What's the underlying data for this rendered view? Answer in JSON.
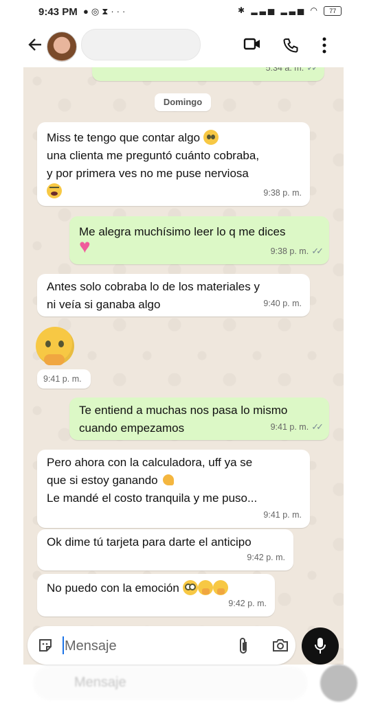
{
  "status_bar": {
    "time": "9:43 PM",
    "battery": "77"
  },
  "header": {
    "back_icon": "arrow-left-icon",
    "video_icon": "video-call-icon",
    "call_icon": "phone-icon",
    "menu_icon": "more-vert-icon"
  },
  "chat": {
    "prev_time": "5:34 a. m.",
    "day_label": "Domingo",
    "messages": [
      {
        "dir": "in",
        "lines": [
          "Miss te tengo que contar algo",
          "una clienta me preguntó cuánto cobraba,",
          "y por primera ves no me puse nerviosa"
        ],
        "time": "9:38 p. m."
      },
      {
        "dir": "out",
        "lines": [
          "Me alegra muchísimo leer lo q me dices"
        ],
        "time": "9:38 p. m."
      },
      {
        "dir": "in",
        "lines": [
          "Antes solo cobraba lo de los materiales y",
          "ni veía si ganaba algo"
        ],
        "time": "9:40 p. m."
      },
      {
        "dir": "in",
        "lines": [],
        "time": "9:41 p. m."
      },
      {
        "dir": "out",
        "lines": [
          "Te entiend a muchas nos pasa lo mismo",
          "cuando empezamos"
        ],
        "time": "9:41 p. m."
      },
      {
        "dir": "in",
        "lines": [
          "Pero ahora con la calculadora, uff ya se",
          "que si estoy ganando",
          "Le mandé el costo tranquila y me puso..."
        ],
        "time": "9:41 p. m."
      },
      {
        "dir": "in",
        "lines": [
          "Ok dime tú tarjeta para darte el anticipo"
        ],
        "time": "9:42 p. m."
      },
      {
        "dir": "in",
        "lines": [
          "No puedo con la emoción"
        ],
        "time": "9:42 p. m."
      }
    ]
  },
  "composer": {
    "placeholder": "Mensaje"
  },
  "ghost": {
    "placeholder": "Mensaje"
  },
  "colors": {
    "incoming": "#ffffff",
    "outgoing": "#dcf8c6",
    "chat_bg": "#efe7dd"
  }
}
